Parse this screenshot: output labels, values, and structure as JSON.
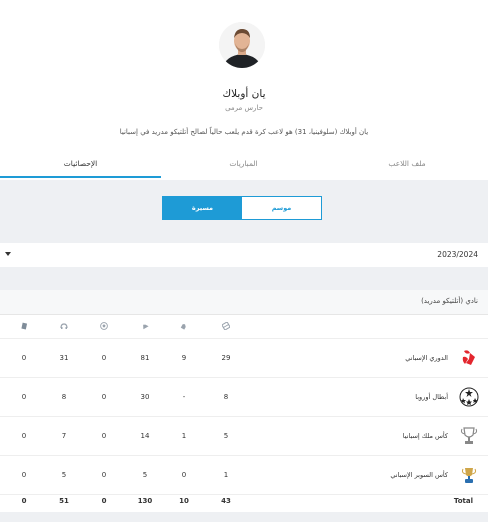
{
  "player": {
    "name": "يان أوبلاك",
    "position": "حارس مرمى",
    "bio": "يان أوبلاك (سلوفينيا، 31) هو لاعب كرة قدم يلعب حالياً لصالح أتلتيكو مدريد في إسبانيا"
  },
  "tabs": [
    {
      "label": "ملف اللاعب"
    },
    {
      "label": "المباريات"
    },
    {
      "label": "الإحصائيات"
    }
  ],
  "toggle": {
    "on": "مسيرة",
    "off": "موسم"
  },
  "season": "2023/2024",
  "club": "نادي (أتلتيكو مدريد)",
  "stat_icons": [
    "pitch-icon",
    "shoe-icon",
    "boot-icon",
    "ball-icon",
    "whistle-icon",
    "card-icon"
  ],
  "competitions": [
    {
      "name": "الدوري الإسباني",
      "logo": "laliga-logo",
      "values": [
        "29",
        "9",
        "81",
        "0",
        "31",
        "0"
      ]
    },
    {
      "name": "أبطال أوروبا",
      "logo": "ucl-logo",
      "values": [
        "8",
        "-",
        "30",
        "0",
        "8",
        "0"
      ]
    },
    {
      "name": "كأس ملك إسبانيا",
      "logo": "copa-logo",
      "values": [
        "5",
        "1",
        "14",
        "0",
        "7",
        "0"
      ]
    },
    {
      "name": "كأس السوبر الإسباني",
      "logo": "supercopa-logo",
      "values": [
        "1",
        "0",
        "5",
        "0",
        "5",
        "0"
      ]
    }
  ],
  "total": {
    "label": "Total",
    "values": [
      "43",
      "10",
      "130",
      "0",
      "51",
      "0"
    ]
  },
  "colors": {
    "accent": "#1e9bd6",
    "laliga": "#e3262e"
  }
}
